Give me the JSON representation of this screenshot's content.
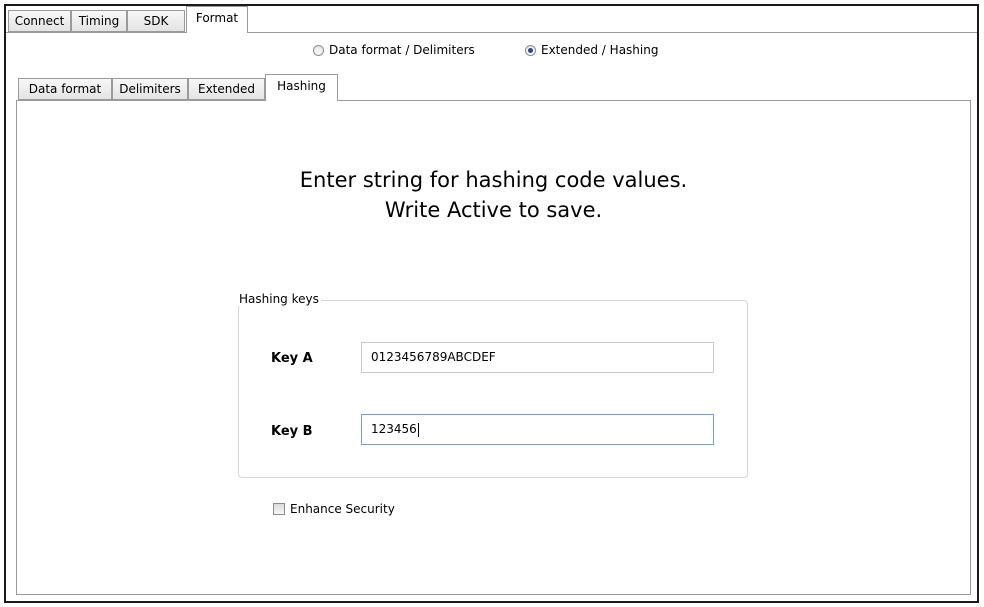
{
  "top_tabs": [
    "Connect",
    "Timing",
    "SDK",
    "Format"
  ],
  "mode_options": [
    {
      "label": "Data format / Delimiters",
      "checked": false
    },
    {
      "label": "Extended / Hashing",
      "checked": true
    }
  ],
  "sub_tabs": [
    "Data format",
    "Delimiters",
    "Extended",
    "Hashing"
  ],
  "hashing": {
    "instruction_line1": "Enter string for hashing code values.",
    "instruction_line2": "Write Active to save.",
    "group_title": "Hashing keys",
    "key_a_label": "Key A",
    "key_a_value": "0123456789ABCDEF",
    "key_b_label": "Key B",
    "key_b_value": "123456",
    "enhance_security_label": "Enhance Security",
    "enhance_security_checked": false
  }
}
